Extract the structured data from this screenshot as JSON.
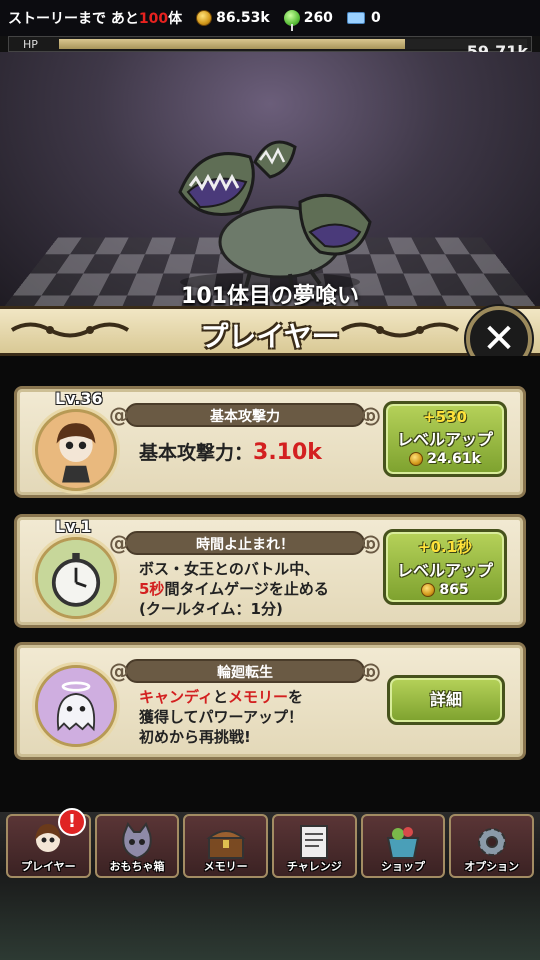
{
  "topbar": {
    "story_prefix": "ストーリーまで あと",
    "story_count": "100",
    "story_suffix": "体",
    "coins": "86.53k",
    "candy": "260",
    "tickets": "0"
  },
  "hp": {
    "label": "HP",
    "value": "59.71k",
    "fill_fraction": 0.74
  },
  "monster": {
    "name": "101体目の夢喰い"
  },
  "panel": {
    "title": "プレイヤー",
    "close_icon": "close-icon"
  },
  "cards": [
    {
      "level": "Lv.36",
      "title": "基本攻撃力",
      "desc_label": "基本攻撃力：",
      "desc_value": "3.10k",
      "button_plus": "+530",
      "button_label": "レベルアップ",
      "button_cost": "24.61k"
    },
    {
      "level": "Lv.1",
      "title": "時間よ止まれ！",
      "desc_line1": "ボス・女王とのバトル中、",
      "desc_line2_red": "5秒",
      "desc_line2_rest": "間タイムゲージを止める",
      "desc_line3": "(クールタイム：1分)",
      "button_plus": "+0.1秒",
      "button_label": "レベルアップ",
      "button_cost": "865"
    },
    {
      "title": "輪廻転生",
      "desc_red1": "キャンディ",
      "desc_mid": "と",
      "desc_red2": "メモリー",
      "desc_end": "を",
      "desc_line2": "獲得してパワーアップ！",
      "desc_line3": "初めから再挑戦!",
      "button_label": "詳細"
    }
  ],
  "nav": {
    "badge": "!",
    "tabs": [
      "プレイヤー",
      "おもちゃ箱",
      "メモリー",
      "チャレンジ",
      "ショップ",
      "オプション"
    ]
  },
  "colors": {
    "accent_red": "#e8221f",
    "button_green": "#7da12e",
    "frame_brown": "#8a7650"
  }
}
